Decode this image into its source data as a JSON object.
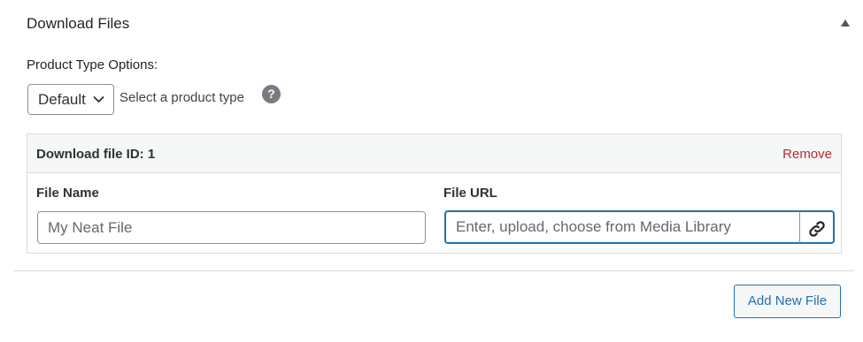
{
  "panel": {
    "title": "Download Files",
    "collapse_icon": "triangle-up-icon"
  },
  "product_type": {
    "label": "Product Type Options:",
    "selected": "Default",
    "hint": "Select a product type",
    "help_glyph": "?"
  },
  "download_file": {
    "id_label": "Download file ID: 1",
    "remove_label": "Remove",
    "file_name_label": "File Name",
    "file_name_placeholder": "My Neat File",
    "file_url_label": "File URL",
    "file_url_placeholder": "Enter, upload, choose from Media Library",
    "link_icon": "link-icon"
  },
  "actions": {
    "add_new_label": "Add New File"
  },
  "colors": {
    "accent": "#2271b1",
    "danger": "#b32d2e",
    "border": "#dcdcde"
  }
}
